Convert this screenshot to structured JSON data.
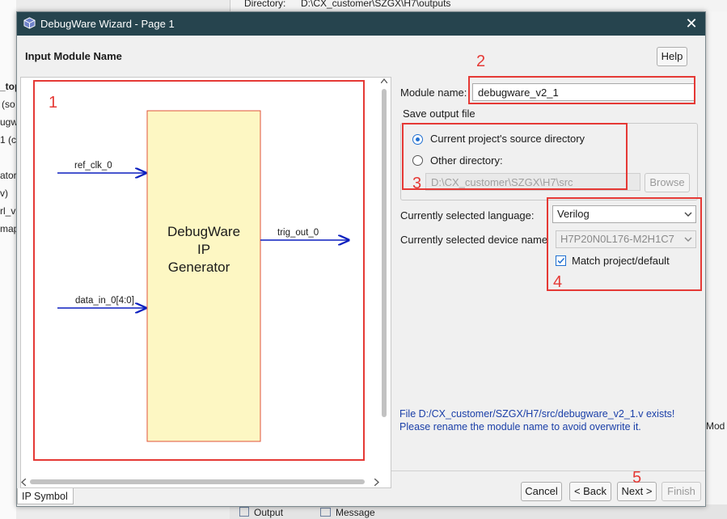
{
  "background": {
    "directory_label": "Directory:",
    "directory_value": "D:\\CX_customer\\SZGX\\H7\\outputs",
    "left_fragments": [
      "_top",
      "(so",
      "ugw",
      "1 (c",
      "ator",
      "v)",
      "rl_v",
      "map"
    ],
    "right_fragment": "Mod",
    "bottom_tabs": [
      "Output",
      "Message"
    ]
  },
  "dialog": {
    "title": "DebugWare Wizard - Page 1",
    "heading": "Input Module Name",
    "help_label": "Help",
    "close_glyph": "✕"
  },
  "symbol": {
    "block_title_lines": [
      "DebugWare",
      "IP",
      "Generator"
    ],
    "ports": {
      "ref_clk": "ref_clk_0",
      "data_in": "data_in_0[4:0]",
      "trig_out": "trig_out_0"
    },
    "tab_label": "IP Symbol"
  },
  "form": {
    "module_name_label": "Module name:",
    "module_name_value": "debugware_v2_1",
    "save_output_label": "Save output file",
    "radio_current": "Current project's source directory",
    "radio_other": "Other directory:",
    "other_dir_value": "D:\\CX_customer\\SZGX\\H7\\src",
    "browse_label": "Browse",
    "language_label": "Currently selected language:",
    "language_value": "Verilog",
    "device_label": "Currently selected device name",
    "device_value": "H7P20N0L176-M2H1C7",
    "match_label": "Match project/default",
    "notice_line1": "File D:/CX_customer/SZGX/H7/src/debugware_v2_1.v exists!",
    "notice_line2": "Please rename the module name to avoid overwrite it."
  },
  "footer": {
    "cancel": "Cancel",
    "back": "< Back",
    "next": "Next >",
    "finish": "Finish"
  },
  "annotations": [
    "1",
    "2",
    "3",
    "4",
    "5"
  ],
  "colors": {
    "titlebar": "#26444e",
    "annotation_red": "#e53935",
    "block_fill": "#fdf7c3",
    "wire_blue": "#0b1fbf",
    "notice_blue": "#1a3fa8",
    "radio_accent": "#1f6fd1"
  }
}
